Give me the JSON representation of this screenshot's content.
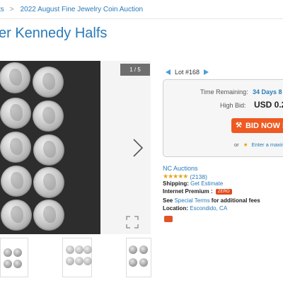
{
  "breadcrumb": {
    "items": [
      "ts",
      "2022 August Fine Jewelry Coin Auction"
    ],
    "separator": ">"
  },
  "page": {
    "title": "er Kennedy Halfs"
  },
  "gallery": {
    "counter": "1 / 5",
    "thumb_count_visible": 3
  },
  "lot": {
    "label": "Lot #168"
  },
  "bidding": {
    "time_remaining_label": "Time Remaining:",
    "time_remaining_value": "34 Days 8",
    "high_bid_label": "High Bid:",
    "high_bid_value": "USD 0.2",
    "bid_button_label": "BID NOW S",
    "or_label": "or",
    "max_bid_link": "Enter a maxim"
  },
  "seller": {
    "name": "NC Auctions",
    "rating_count": "(2138)",
    "shipping_label": "Shipping:",
    "shipping_value": "Get Estimate",
    "premium_label": "Internet Premium :",
    "premium_badge": "ZERO",
    "terms_prefix": "See",
    "terms_link": "Special Terms",
    "terms_suffix": "for additional fees",
    "location_label": "Location:",
    "location_value": "Escondido, CA"
  },
  "colors": {
    "link": "#2a7ab8",
    "bid_button": "#ee5a21",
    "star": "#e8a317"
  },
  "icons": [
    "chevron-right-icon",
    "expand-icon",
    "prev-lot-icon",
    "next-lot-icon",
    "gavel-icon",
    "star-icon",
    "rating-stars-icon"
  ]
}
